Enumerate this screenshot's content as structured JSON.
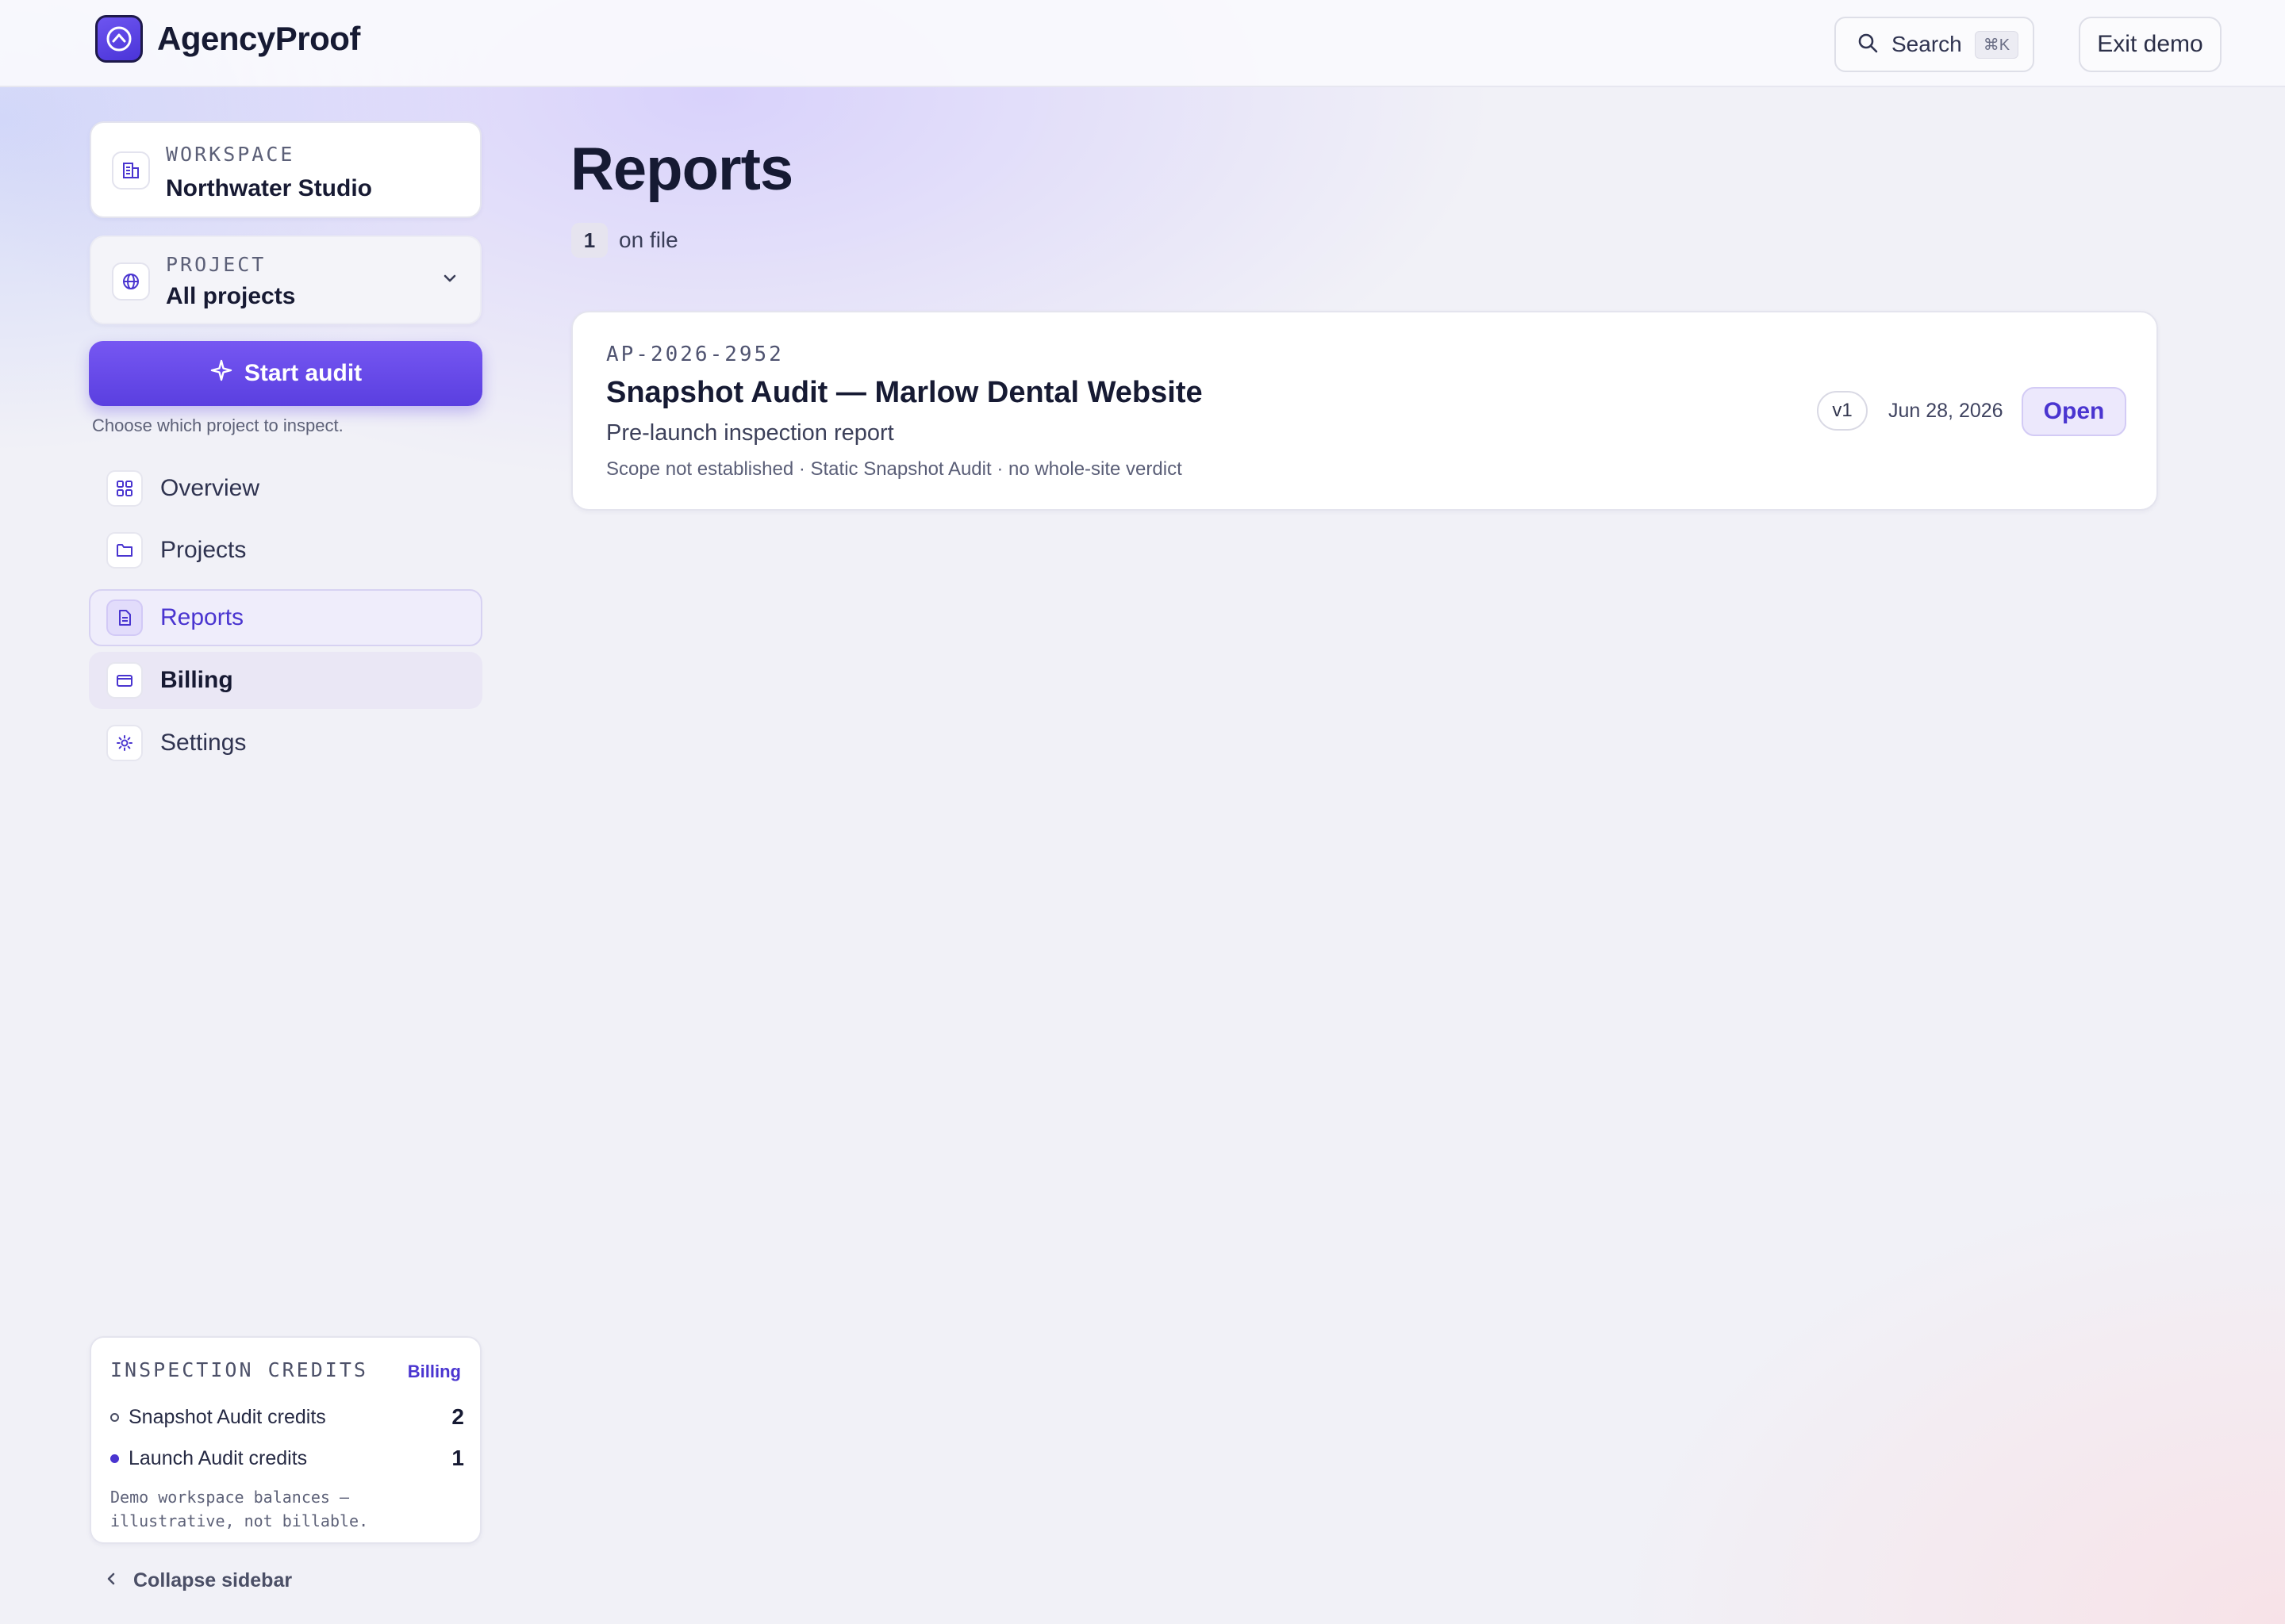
{
  "app": {
    "name": "AgencyProof"
  },
  "header": {
    "search_label": "Search",
    "search_shortcut": "⌘K",
    "exit_label": "Exit demo"
  },
  "sidebar": {
    "workspace": {
      "kicker": "WORKSPACE",
      "value": "Northwater Studio"
    },
    "project": {
      "kicker": "PROJECT",
      "value": "All projects"
    },
    "start_audit_label": "Start audit",
    "start_audit_hint": "Choose which project to inspect.",
    "nav": [
      {
        "label": "Overview",
        "icon": "grid-icon",
        "state": "default"
      },
      {
        "label": "Projects",
        "icon": "folder-icon",
        "state": "default"
      },
      {
        "label": "Reports",
        "icon": "document-icon",
        "state": "active"
      },
      {
        "label": "Billing",
        "icon": "credit-card-icon",
        "state": "hover"
      },
      {
        "label": "Settings",
        "icon": "gear-icon",
        "state": "default"
      }
    ],
    "credits": {
      "title": "INSPECTION CREDITS",
      "link": "Billing",
      "rows": [
        {
          "label": "Snapshot Audit credits",
          "value": "2",
          "dot": "hollow"
        },
        {
          "label": "Launch Audit credits",
          "value": "1",
          "dot": "filled"
        }
      ],
      "note": "Demo workspace balances — illustrative, not billable."
    },
    "collapse_label": "Collapse sidebar"
  },
  "main": {
    "title": "Reports",
    "count": "1",
    "count_label": "on file",
    "reports": [
      {
        "id": "AP-2026-2952",
        "title": "Snapshot Audit — Marlow Dental Website",
        "subtitle": "Pre-launch inspection report",
        "meta": "Scope not established · Static Snapshot Audit · no whole-site verdict",
        "version": "v1",
        "date": "Jun 28, 2026",
        "action": "Open"
      }
    ]
  },
  "colors": {
    "accent": "#5a3fe0",
    "accent_text": "#4a35d0",
    "ink": "#161a33"
  }
}
